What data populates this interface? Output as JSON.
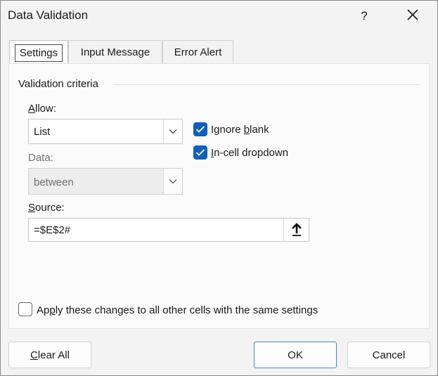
{
  "window": {
    "title": "Data Validation",
    "help_label": "?",
    "close_icon": "close-icon"
  },
  "tabs": [
    {
      "label": "Settings",
      "active": true
    },
    {
      "label": "Input Message",
      "active": false
    },
    {
      "label": "Error Alert",
      "active": false
    }
  ],
  "settings": {
    "group_label": "Validation criteria",
    "allow": {
      "label_mnemonic": "A",
      "label_rest": "llow:",
      "value": "List"
    },
    "data": {
      "label": "Data:",
      "value": "between",
      "disabled": true
    },
    "source": {
      "label_mnemonic": "S",
      "label_rest": "ource:",
      "value": "=$E$2#",
      "collapse_icon": "arrow-up-icon"
    },
    "ignore_blank": {
      "label_before": "Ignore ",
      "label_mnemonic": "b",
      "label_after": "lank",
      "checked": true
    },
    "in_cell_dropdown": {
      "label_mnemonic": "I",
      "label_after": "n-cell dropdown",
      "checked": true
    },
    "apply_all": {
      "label_before": "Ap",
      "label_mnemonic": "p",
      "label_after": "ly these changes to all other cells with the same settings",
      "checked": false
    }
  },
  "buttons": {
    "clear_all_mnemonic": "C",
    "clear_all_rest": "lear All",
    "ok": "OK",
    "cancel": "Cancel"
  },
  "colors": {
    "accent": "#1060b8",
    "default_button_border": "#4f83c7"
  }
}
